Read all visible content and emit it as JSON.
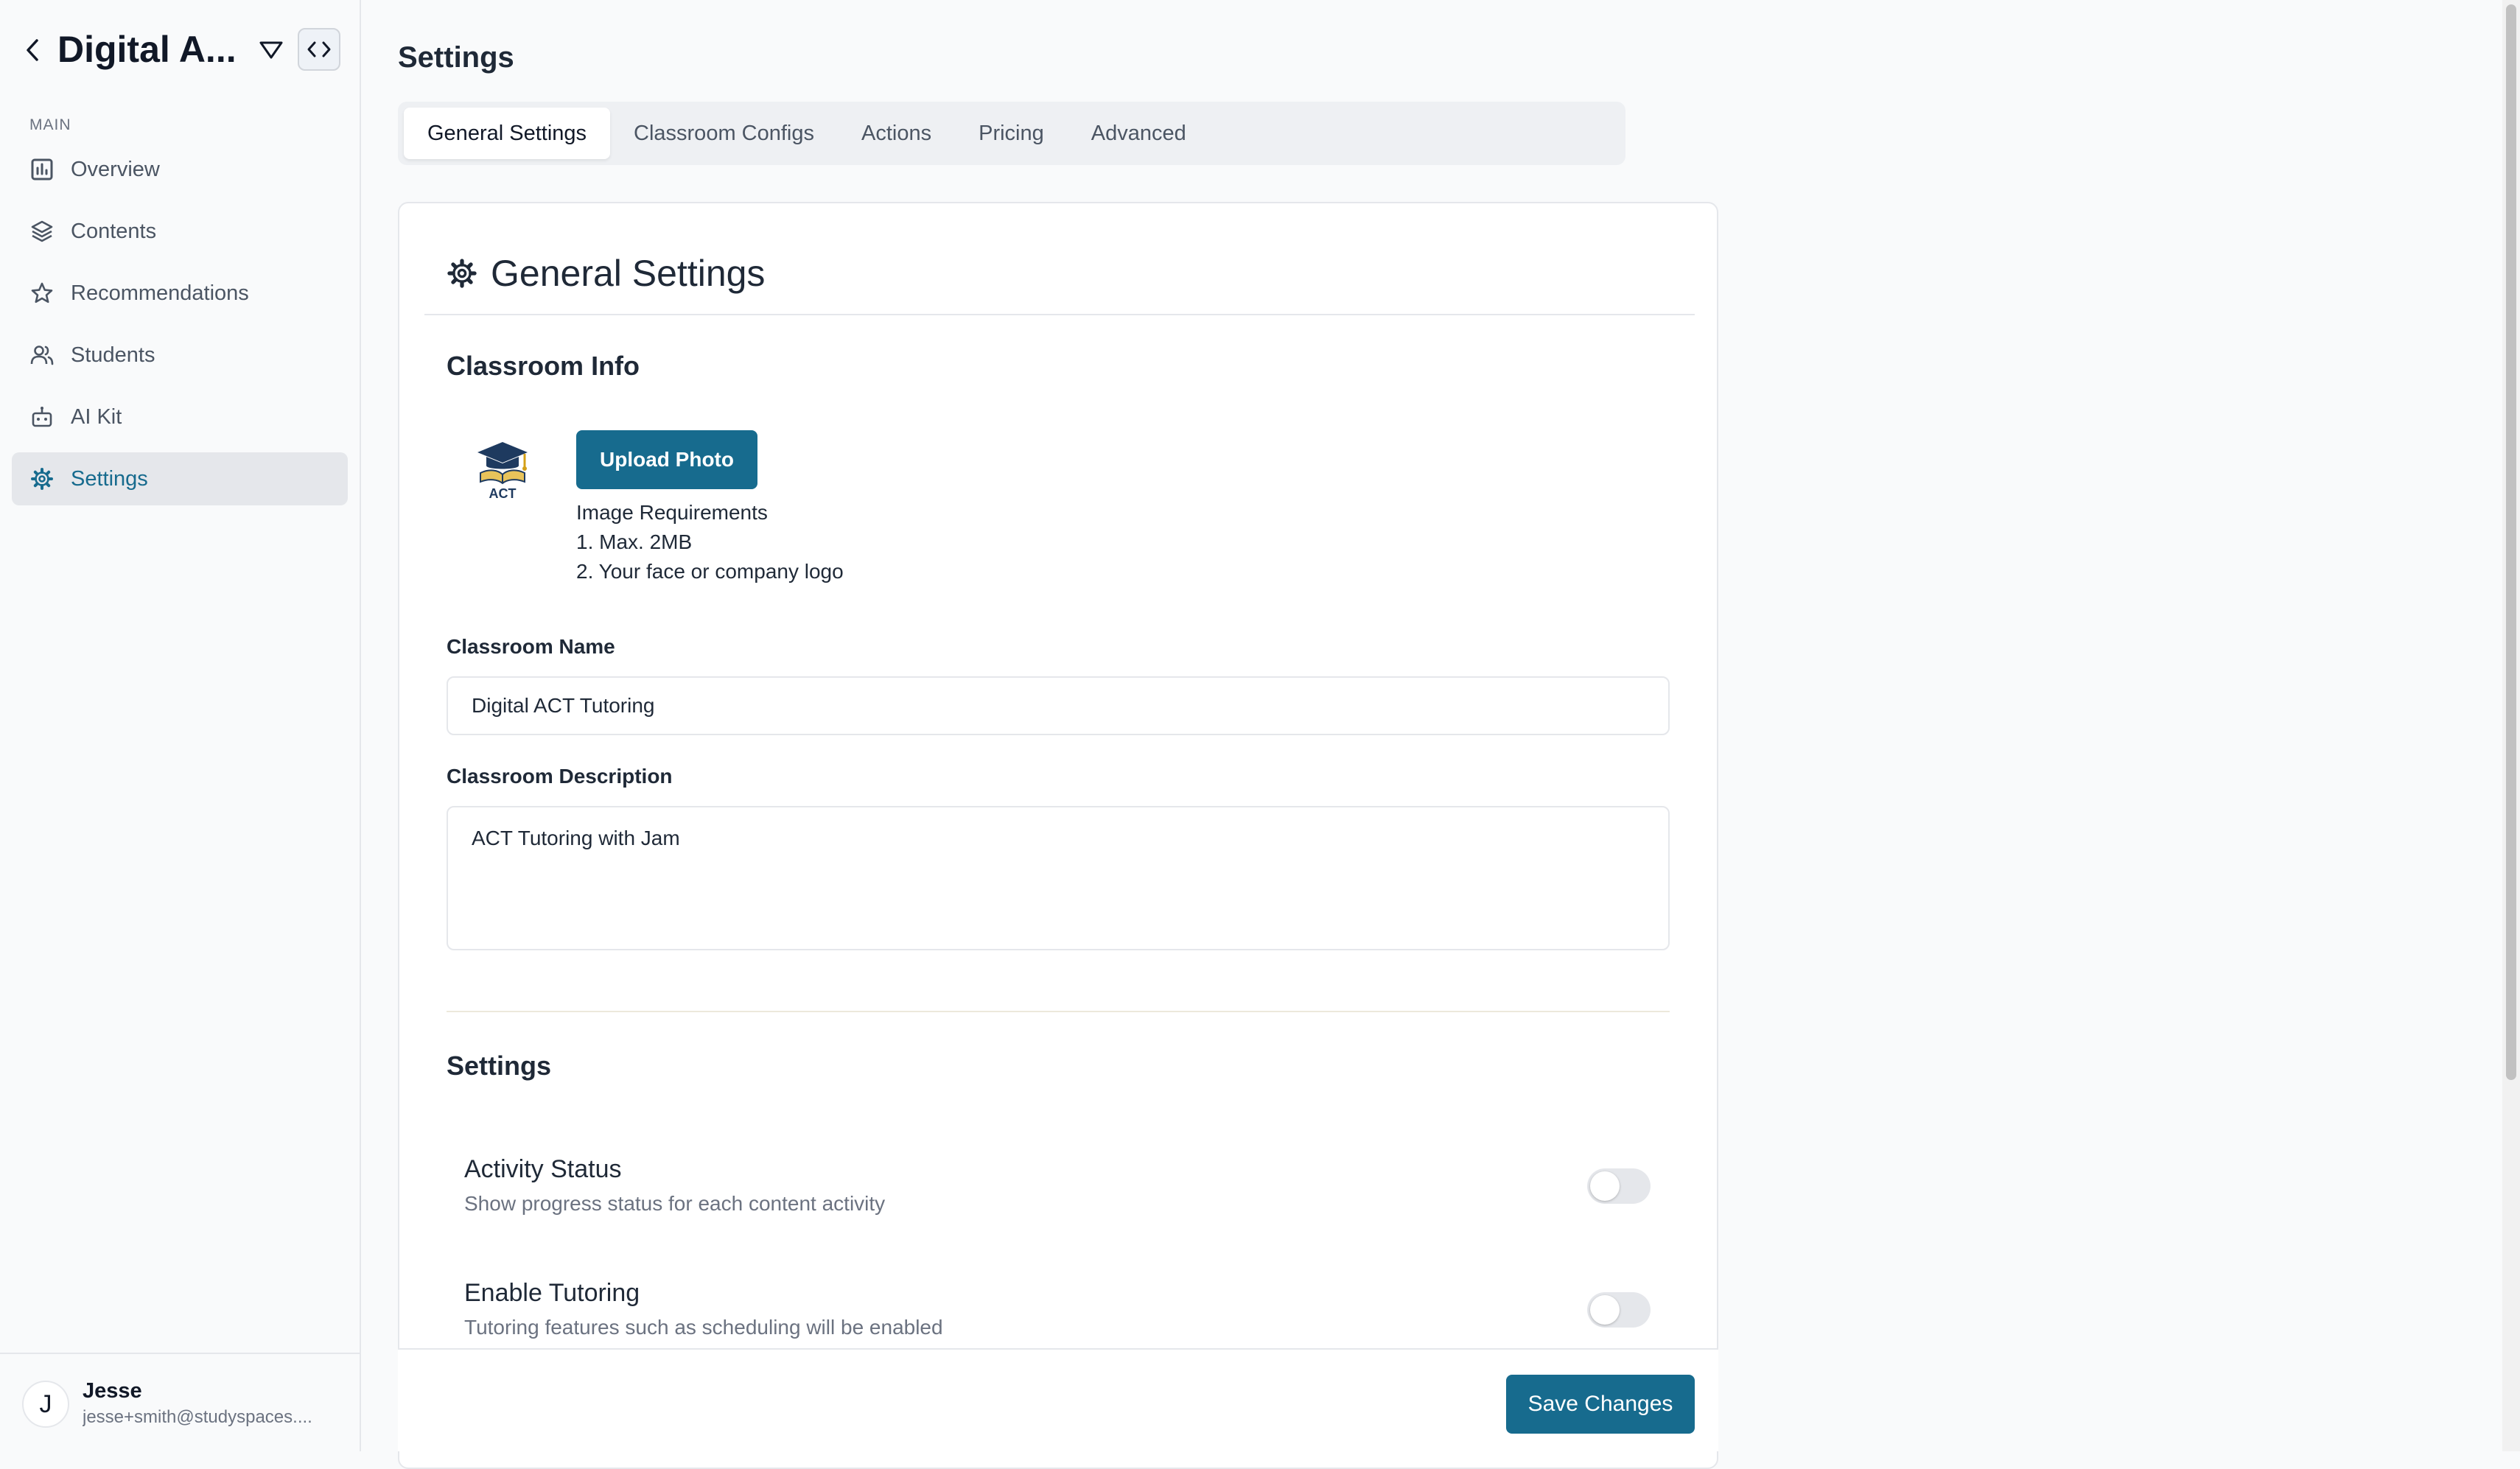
{
  "sidebar": {
    "title": "Digital A...",
    "section_label": "MAIN",
    "items": [
      {
        "label": "Overview",
        "icon": "chart-icon",
        "active": false
      },
      {
        "label": "Contents",
        "icon": "layers-icon",
        "active": false
      },
      {
        "label": "Recommendations",
        "icon": "star-icon",
        "active": false
      },
      {
        "label": "Students",
        "icon": "users-icon",
        "active": false
      },
      {
        "label": "AI Kit",
        "icon": "robot-icon",
        "active": false
      },
      {
        "label": "Settings",
        "icon": "gear-icon",
        "active": true
      }
    ],
    "user": {
      "initial": "J",
      "name": "Jesse",
      "email": "jesse+smith@studyspaces...."
    }
  },
  "main": {
    "page_title": "Settings",
    "tabs": [
      {
        "label": "General Settings",
        "active": true
      },
      {
        "label": "Classroom Configs",
        "active": false
      },
      {
        "label": "Actions",
        "active": false
      },
      {
        "label": "Pricing",
        "active": false
      },
      {
        "label": "Advanced",
        "active": false
      }
    ],
    "card": {
      "title": "General Settings",
      "classroom_info": {
        "heading": "Classroom Info",
        "logo_text": "ACT",
        "upload_label": "Upload Photo",
        "requirements": [
          "Image Requirements",
          "1. Max. 2MB",
          "2. Your face or company logo"
        ]
      },
      "classroom_name": {
        "label": "Classroom Name",
        "value": "Digital ACT Tutoring"
      },
      "classroom_description": {
        "label": "Classroom Description",
        "value": "ACT Tutoring with Jam"
      },
      "settings": {
        "heading": "Settings",
        "items": [
          {
            "title": "Activity Status",
            "description": "Show progress status for each content activity",
            "enabled": false
          },
          {
            "title": "Enable Tutoring",
            "description": "Tutoring features such as scheduling will be enabled",
            "enabled": false
          }
        ]
      }
    },
    "save_label": "Save Changes"
  },
  "colors": {
    "accent": "#176b8e",
    "active_nav_bg": "#e5e7eb",
    "toggle_off": "#e5e7eb"
  }
}
